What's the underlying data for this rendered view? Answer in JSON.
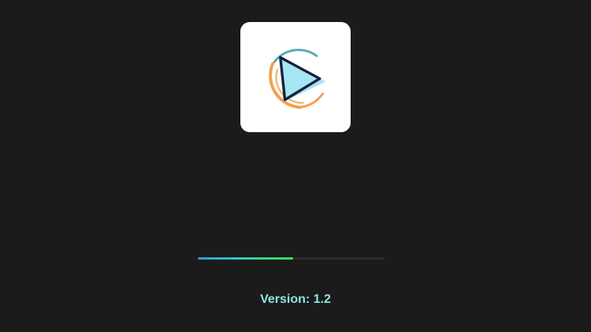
{
  "app": {
    "logo_icon": "play-logo-icon"
  },
  "progress": {
    "fraction": 0.51,
    "gradient_start": "#2f9be0",
    "gradient_end": "#3ee04a",
    "track_color": "#2b2b2b"
  },
  "version": {
    "label": "Version: ",
    "number": "1.2",
    "color": "#8fe3e0"
  },
  "colors": {
    "background": "#1b1b1b",
    "card": "#ffffff",
    "logo_cyan": "#a5e7f0",
    "logo_navy": "#16213e",
    "logo_orange": "#f0a050",
    "logo_teal": "#5aa8b4"
  }
}
